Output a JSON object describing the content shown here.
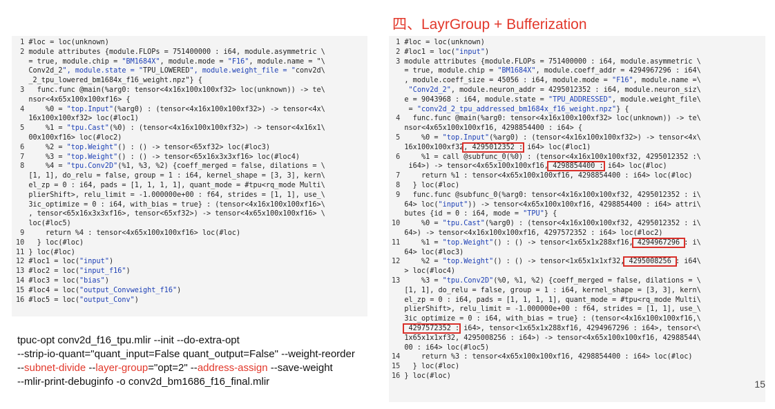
{
  "slide": {
    "title": "四、LayrGroup + Bufferization",
    "page_number": "15",
    "accent_color": "#e2382b",
    "string_color": "#1c3fb5",
    "panel_background": "#f4f4f4"
  },
  "left_code": [
    {
      "n": "1",
      "t": "#loc = loc(unknown)"
    },
    {
      "n": "2",
      "t": "module attributes {module.FLOPs = 751400000 : i64, module.asymmetric \\"
    },
    {
      "n": "",
      "t": "= true, module.chip = \"BM1684X\", module.mode = \"F16\", module.name = \"\\"
    },
    {
      "n": "",
      "t": "Conv2d_2\", module.state = \"TPU_LOWERED\", module.weight_file = \"conv2d\\"
    },
    {
      "n": "",
      "t": "_2_tpu_lowered_bm1684x_f16_weight.npz\"} {"
    },
    {
      "n": "3",
      "t": "  func.func @main(%arg0: tensor<4x16x100x100xf32> loc(unknown)) -> te\\"
    },
    {
      "n": "",
      "t": "nsor<4x65x100x100xf16> {"
    },
    {
      "n": "4",
      "t": "    %0 = \"top.Input\"(%arg0) : (tensor<4x16x100x100xf32>) -> tensor<4x\\"
    },
    {
      "n": "",
      "t": "16x100x100xf32> loc(#loc1)"
    },
    {
      "n": "5",
      "t": "    %1 = \"tpu.Cast\"(%0) : (tensor<4x16x100x100xf32>) -> tensor<4x16x1\\"
    },
    {
      "n": "",
      "t": "00x100xf16> loc(#loc2)"
    },
    {
      "n": "6",
      "t": "    %2 = \"top.Weight\"() : () -> tensor<65xf32> loc(#loc3)"
    },
    {
      "n": "7",
      "t": "    %3 = \"top.Weight\"() : () -> tensor<65x16x3x3xf16> loc(#loc4)"
    },
    {
      "n": "8",
      "t": "    %4 = \"tpu.Conv2D\"(%1, %3, %2) {coeff_merged = false, dilations = \\"
    },
    {
      "n": "",
      "t": "[1, 1], do_relu = false, group = 1 : i64, kernel_shape = [3, 3], kern\\"
    },
    {
      "n": "",
      "t": "el_zp = 0 : i64, pads = [1, 1, 1, 1], quant_mode = #tpu<rq_mode Multi\\"
    },
    {
      "n": "",
      "t": "plierShift>, relu_limit = -1.000000e+00 : f64, strides = [1, 1], use_\\"
    },
    {
      "n": "",
      "t": "3ic_optimize = 0 : i64, with_bias = true} : (tensor<4x16x100x100xf16>\\"
    },
    {
      "n": "",
      "t": ", tensor<65x16x3x3xf16>, tensor<65xf32>) -> tensor<4x65x100x100xf16> \\"
    },
    {
      "n": "",
      "t": "loc(#loc5)"
    },
    {
      "n": "9",
      "t": "    return %4 : tensor<4x65x100x100xf16> loc(#loc)"
    },
    {
      "n": "10",
      "t": "  } loc(#loc)"
    },
    {
      "n": "11",
      "t": "} loc(#loc)"
    },
    {
      "n": "12",
      "t": "#loc1 = loc(\"input\")"
    },
    {
      "n": "13",
      "t": "#loc2 = loc(\"input_f16\")"
    },
    {
      "n": "14",
      "t": "#loc3 = loc(\"bias\")"
    },
    {
      "n": "15",
      "t": "#loc4 = loc(\"output_Convweight_f16\")"
    },
    {
      "n": "16",
      "t": "#loc5 = loc(\"output_Conv\")"
    }
  ],
  "right_code": [
    {
      "n": "1",
      "t": "#loc = loc(unknown)"
    },
    {
      "n": "2",
      "t": "#loc1 = loc(\"input\")"
    },
    {
      "n": "3",
      "t": "module attributes {module.FLOPs = 751400000 : i64, module.asymmetric \\"
    },
    {
      "n": "",
      "t": "= true, module.chip = \"BM1684X\", module.coeff_addr = 4294967296 : i64\\"
    },
    {
      "n": "",
      "t": ", module.coeff_size = 45056 : i64, module.mode = \"F16\", module.name =\\"
    },
    {
      "n": "",
      "t": " \"Conv2d_2\", module.neuron_addr = 4295012352 : i64, module.neuron_siz\\"
    },
    {
      "n": "",
      "t": "e = 9043968 : i64, module.state = \"TPU_ADDRESSED\", module.weight_file\\"
    },
    {
      "n": "",
      "t": " = \"conv2d_2_tpu_addressed_bm1684x_f16_weight.npz\"} {"
    },
    {
      "n": "4",
      "t": "  func.func @main(%arg0: tensor<4x16x100x100xf32> loc(unknown)) -> te\\"
    },
    {
      "n": "",
      "t": "nsor<4x65x100x100xf16, 4298854400 : i64> {"
    },
    {
      "n": "5",
      "t": "    %0 = \"top.Input\"(%arg0) : (tensor<4x16x100x100xf32>) -> tensor<4x\\"
    },
    {
      "n": "",
      "t": "16x100x100xf32",
      "h": ", 4295012352 :",
      "a": " i64> loc(#loc1)"
    },
    {
      "n": "6",
      "t": "    %1 = call @subfunc_0(%0) : (tensor<4x16x100x100xf32, 4295012352 :\\"
    },
    {
      "n": "",
      "t": " i64>) -> tensor<4x65x100x100xf16,",
      "h": " 4298854400 :",
      "a": " i64> loc(#loc)"
    },
    {
      "n": "7",
      "t": "    return %1 : tensor<4x65x100x100xf16, 4298854400 : i64> loc(#loc)"
    },
    {
      "n": "8",
      "t": "  } loc(#loc)"
    },
    {
      "n": "9",
      "t": "  func.func @subfunc_0(%arg0: tensor<4x16x100x100xf32, 4295012352 : i\\"
    },
    {
      "n": "",
      "t": "64> loc(\"input\")) -> tensor<4x65x100x100xf16, 4298854400 : i64> attri\\"
    },
    {
      "n": "",
      "t": "butes {id = 0 : i64, mode = \"TPU\"} {"
    },
    {
      "n": "10",
      "t": "    %0 = \"tpu.Cast\"(%arg0) : (tensor<4x16x100x100xf32, 4295012352 : i\\"
    },
    {
      "n": "",
      "t": "64>) -> tensor<4x16x100x100xf16, 4297572352 : i64> loc(#loc2)"
    },
    {
      "n": "11",
      "t": "    %1 = \"top.Weight\"() : () -> tensor<1x65x1x288xf16,",
      "h": " 4294967296 ",
      "a": ": i\\"
    },
    {
      "n": "",
      "t": "64> loc(#loc3)"
    },
    {
      "n": "12",
      "t": "    %2 = \"top.Weight\"() : () -> tensor<1x65x1x1xf32,",
      "h": " 4295008256 ",
      "a": ": i64\\"
    },
    {
      "n": "",
      "t": "> loc(#loc4)"
    },
    {
      "n": "13",
      "t": "    %3 = \"tpu.Conv2D\"(%0, %1, %2) {coeff_merged = false, dilations = \\"
    },
    {
      "n": "",
      "t": "[1, 1], do_relu = false, group = 1 : i64, kernel_shape = [3, 3], kern\\"
    },
    {
      "n": "",
      "t": "el_zp = 0 : i64, pads = [1, 1, 1, 1], quant_mode = #tpu<rq_mode Multi\\"
    },
    {
      "n": "",
      "t": "plierShift>, relu_limit = -1.000000e+00 : f64, strides = [1, 1], use_\\"
    },
    {
      "n": "",
      "t": "3ic_optimize = 0 : i64, with_bias = true} : (tensor<4x16x100x100xf16,\\"
    },
    {
      "n": "",
      "t": "",
      "h": " 4297572352 :",
      "a": " i64>, tensor<1x65x1x288xf16, 4294967296 : i64>, tensor<\\"
    },
    {
      "n": "",
      "t": "1x65x1x1xf32, 4295008256 : i64>) -> tensor<4x65x100x100xf16, 42988544\\"
    },
    {
      "n": "",
      "t": "00 : i64> loc(#loc5)"
    },
    {
      "n": "14",
      "t": "    return %3 : tensor<4x65x100x100xf16, 4298854400 : i64> loc(#loc)"
    },
    {
      "n": "15",
      "t": "  } loc(#loc)"
    },
    {
      "n": "16",
      "t": "} loc(#loc)"
    }
  ],
  "command": {
    "line1": "tpuc-opt conv2d_f16_tpu.mlir --init --do-extra-opt",
    "line2": "--strip-io-quant=\"quant_input=False quant_output=False\" --weight-reorder",
    "line3_parts": [
      {
        "text": "--",
        "red": false
      },
      {
        "text": "subnet-divide",
        "red": true
      },
      {
        "text": " --",
        "red": false
      },
      {
        "text": "layer-group",
        "red": true
      },
      {
        "text": "=\"opt=2\" --",
        "red": false
      },
      {
        "text": "address-assign",
        "red": true
      },
      {
        "text": " --save-weight",
        "red": false
      }
    ],
    "line4": "--mlir-print-debuginfo -o conv2d_bm1686_f16_final.mlir"
  }
}
